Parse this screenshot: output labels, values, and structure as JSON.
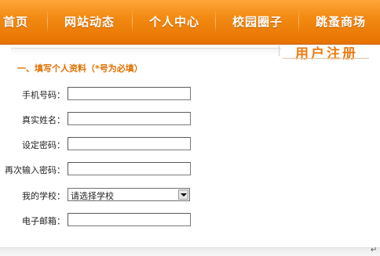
{
  "nav": {
    "items": [
      {
        "label": "首页"
      },
      {
        "label": "网站动态"
      },
      {
        "label": "个人中心"
      },
      {
        "label": "校园圈子"
      },
      {
        "label": "跳蚤商场"
      }
    ]
  },
  "header": {
    "title": "用户注册"
  },
  "form": {
    "section_title": "一、填写个人资料（*号为必填）",
    "fields": [
      {
        "label": "手机号码：",
        "value": ""
      },
      {
        "label": "真实姓名：",
        "value": ""
      },
      {
        "label": "设定密码：",
        "value": ""
      },
      {
        "label": "再次输入密码：",
        "value": ""
      },
      {
        "label": "我的学校：",
        "value": "请选择学校"
      },
      {
        "label": "电子邮箱：",
        "value": ""
      }
    ]
  },
  "footer": {
    "return_mark": "↵"
  }
}
